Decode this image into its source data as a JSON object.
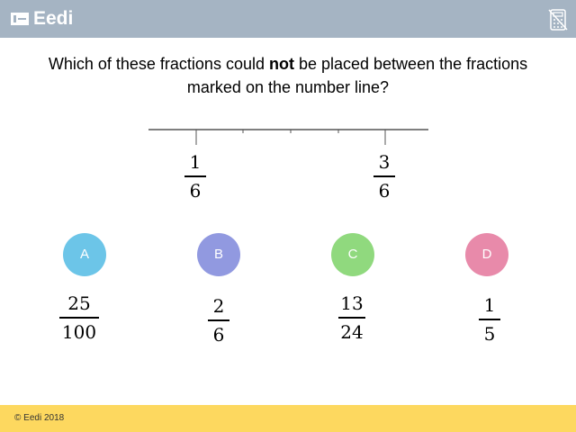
{
  "header": {
    "logo_text": "Eedi",
    "calculator_icon": "calculator-disabled-icon",
    "background": "#a5b4c3"
  },
  "question": {
    "part1": "Which of these fractions could ",
    "emphasis": "not",
    "part2": " be placed between the fractions marked on the number line?"
  },
  "number_line": {
    "marks": [
      {
        "numerator": "1",
        "denominator": "6"
      },
      {
        "numerator": "3",
        "denominator": "6"
      }
    ]
  },
  "options": [
    {
      "letter": "A",
      "color": "#6cc5e8",
      "numerator": "25",
      "denominator": "100"
    },
    {
      "letter": "B",
      "color": "#9199e0",
      "numerator": "2",
      "denominator": "6"
    },
    {
      "letter": "C",
      "color": "#90d97e",
      "numerator": "13",
      "denominator": "24"
    },
    {
      "letter": "D",
      "color": "#e88aaa",
      "numerator": "1",
      "denominator": "5"
    }
  ],
  "footer": {
    "copyright": "© Eedi 2018",
    "background": "#fdd85f"
  }
}
